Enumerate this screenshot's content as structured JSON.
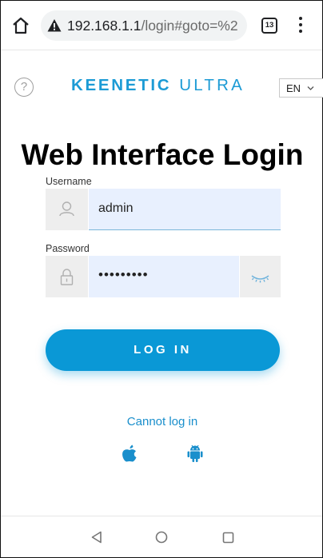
{
  "browser": {
    "url_host": "192.168.1.1",
    "url_path": "/login#goto=%2",
    "tab_count": "13",
    "icons": {
      "home": "home-icon",
      "warning": "warning-icon",
      "menu": "kebab-menu-icon"
    }
  },
  "header": {
    "help_symbol": "?",
    "brand": "KEENETIC",
    "model": "ULTRA",
    "language": "EN",
    "brand_color": "#1c9bd5"
  },
  "form": {
    "title": "Web Interface Login",
    "username_label": "Username",
    "username_value": "admin",
    "password_label": "Password",
    "password_value": "•••••••••",
    "login_button": "LOG IN",
    "button_color": "#0a98d6"
  },
  "footer": {
    "cannot_login": "Cannot log in",
    "app_icons": [
      "apple-icon",
      "android-icon"
    ]
  },
  "system_nav": [
    "back-icon",
    "home-circle-icon",
    "recents-icon"
  ]
}
